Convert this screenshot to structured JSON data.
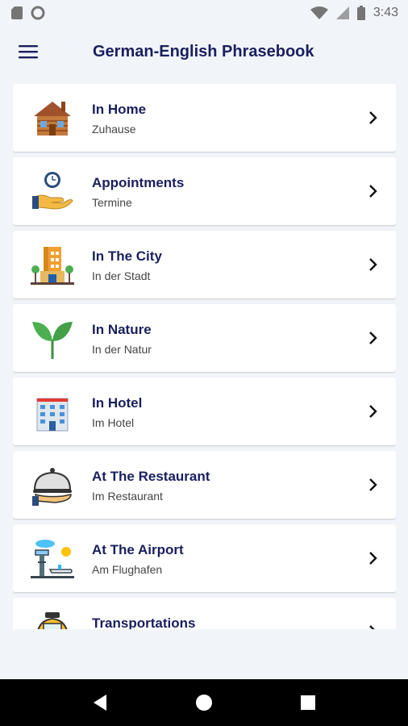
{
  "status_bar": {
    "time": "3:43",
    "icons": [
      "sd-card-icon",
      "circle-icon",
      "wifi-icon",
      "signal-icon",
      "battery-icon"
    ]
  },
  "app_bar": {
    "title": "German-English Phrasebook",
    "menu_icon": "hamburger-menu-icon"
  },
  "categories": [
    {
      "title": "In Home",
      "subtitle": "Zuhause",
      "icon": "house-icon"
    },
    {
      "title": "Appointments",
      "subtitle": "Termine",
      "icon": "clock-hand-icon"
    },
    {
      "title": "In The City",
      "subtitle": "In der Stadt",
      "icon": "city-building-icon"
    },
    {
      "title": "In Nature",
      "subtitle": "In der Natur",
      "icon": "plant-sprout-icon"
    },
    {
      "title": "In Hotel",
      "subtitle": "Im Hotel",
      "icon": "hotel-icon"
    },
    {
      "title": "At The Restaurant",
      "subtitle": "Im Restaurant",
      "icon": "serving-cloche-icon"
    },
    {
      "title": "At The Airport",
      "subtitle": "Am Flughafen",
      "icon": "airport-icon"
    },
    {
      "title": "Transportations",
      "subtitle": "",
      "icon": "taxi-icon"
    }
  ],
  "nav_bar": {
    "icons": [
      "back-icon",
      "home-icon",
      "recents-icon"
    ]
  },
  "colors": {
    "background": "#f1f4f9",
    "title": "#1a1f5e",
    "card": "#ffffff"
  }
}
